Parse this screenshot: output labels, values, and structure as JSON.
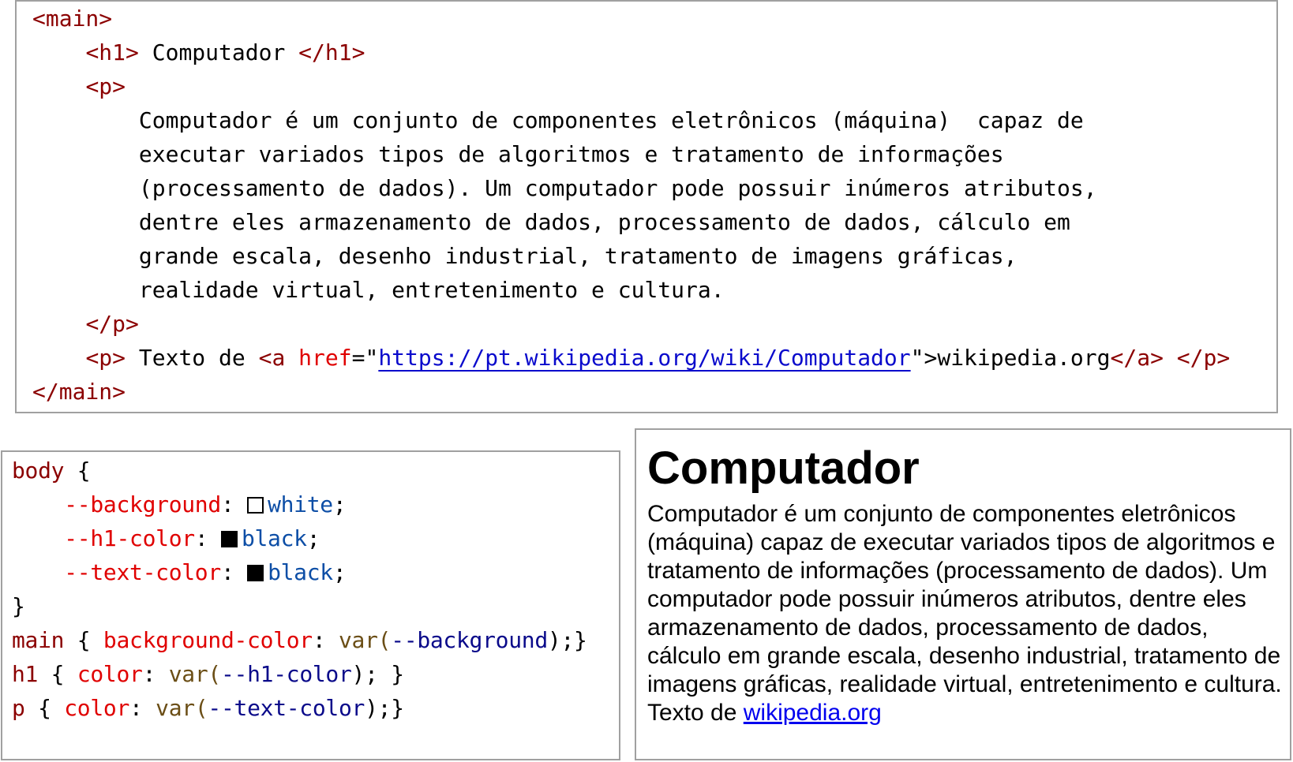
{
  "html_code": {
    "main_open": "<main>",
    "h1_open": "<h1>",
    "h1_text": " Computador ",
    "h1_close": "</h1>",
    "p_open": "<p>",
    "p_lines": [
      "Computador é um conjunto de componentes eletrônicos (máquina)  capaz de",
      "executar variados tipos de algoritmos e tratamento de informações",
      "(processamento de dados). Um computador pode possuir inúmeros atributos,",
      "dentre eles armazenamento de dados, processamento de dados, cálculo em",
      "grande escala, desenho industrial, tratamento de imagens gráficas,",
      "realidade virtual, entretenimento e cultura."
    ],
    "p_close": "</p>",
    "p2_open": "<p>",
    "p2_text": " Texto de ",
    "a_open_start": "<a ",
    "a_attr": "href",
    "a_eq": "=\"",
    "a_url": "https://pt.wikipedia.org/wiki/Computador",
    "a_quote_end": "\"",
    "a_open_end": ">",
    "a_text": "wikipedia.org",
    "a_close": "</a>",
    "p2_close": " </p>",
    "main_close": "</main>"
  },
  "css_code": {
    "body_selector": "body",
    "open_brace": " {",
    "close_brace": "}",
    "vars": [
      {
        "name": "--background",
        "swatch": "#ffffff",
        "value": "white"
      },
      {
        "name": "--h1-color",
        "swatch": "#000000",
        "value": "black"
      },
      {
        "name": "--text-color",
        "swatch": "#000000",
        "value": "black"
      }
    ],
    "rules": [
      {
        "selector": "main",
        "property": "background-color",
        "var_name": "--background",
        "end": ");}"
      },
      {
        "selector": "h1",
        "property": "color",
        "var_name": "--h1-color",
        "end": "); }"
      },
      {
        "selector": "p",
        "property": "color",
        "var_name": "--text-color",
        "end": ");}"
      }
    ],
    "var_fn": "var("
  },
  "preview": {
    "title": "Computador",
    "text": "Computador é um conjunto de componentes eletrônicos (máquina) capaz de executar variados tipos de algoritmos e tratamento de informações (processamento de dados). Um computador pode possuir inúmeros atributos, dentre eles armazenamento de dados, processamento de dados, cálculo em grande escala, desenho industrial, tratamento de imagens gráficas, realidade virtual, entretenimento e cultura.",
    "source_prefix": "Texto de ",
    "link_text": "wikipedia.org"
  },
  "colors": {
    "tag": "#8b0000",
    "attribute": "#e00000",
    "url": "#0a0acc",
    "css_value": "#0d4ea6",
    "link": "#0000ee",
    "border": "#a0a0a0"
  }
}
